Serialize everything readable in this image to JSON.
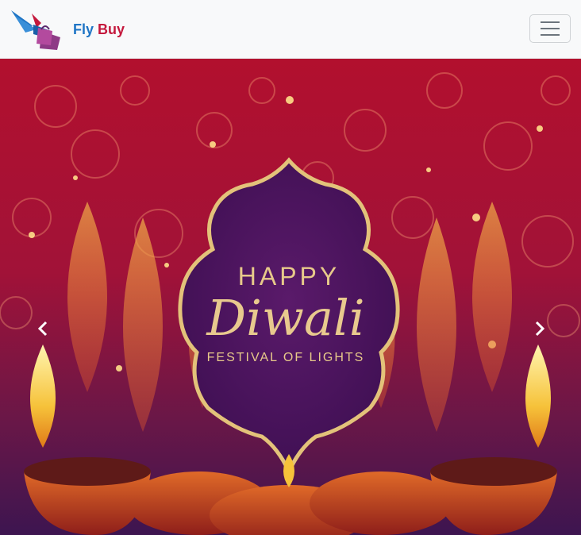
{
  "navbar": {
    "brand_first": "Fly",
    "brand_second": "Buy",
    "logo_icon": "bird-shopping-bags-logo",
    "menu_icon": "hamburger-menu-icon"
  },
  "carousel": {
    "slide": {
      "line1": "HAPPY",
      "line2": "Diwali",
      "line3": "FESTIVAL OF LIGHTS"
    },
    "prev_icon": "chevron-left-icon",
    "next_icon": "chevron-right-icon"
  },
  "colors": {
    "brand_blue": "#1f75c5",
    "brand_red": "#c4183c",
    "banner_red": "#b2102e",
    "banner_purple": "#4a1559",
    "gold": "#e7c98a"
  }
}
